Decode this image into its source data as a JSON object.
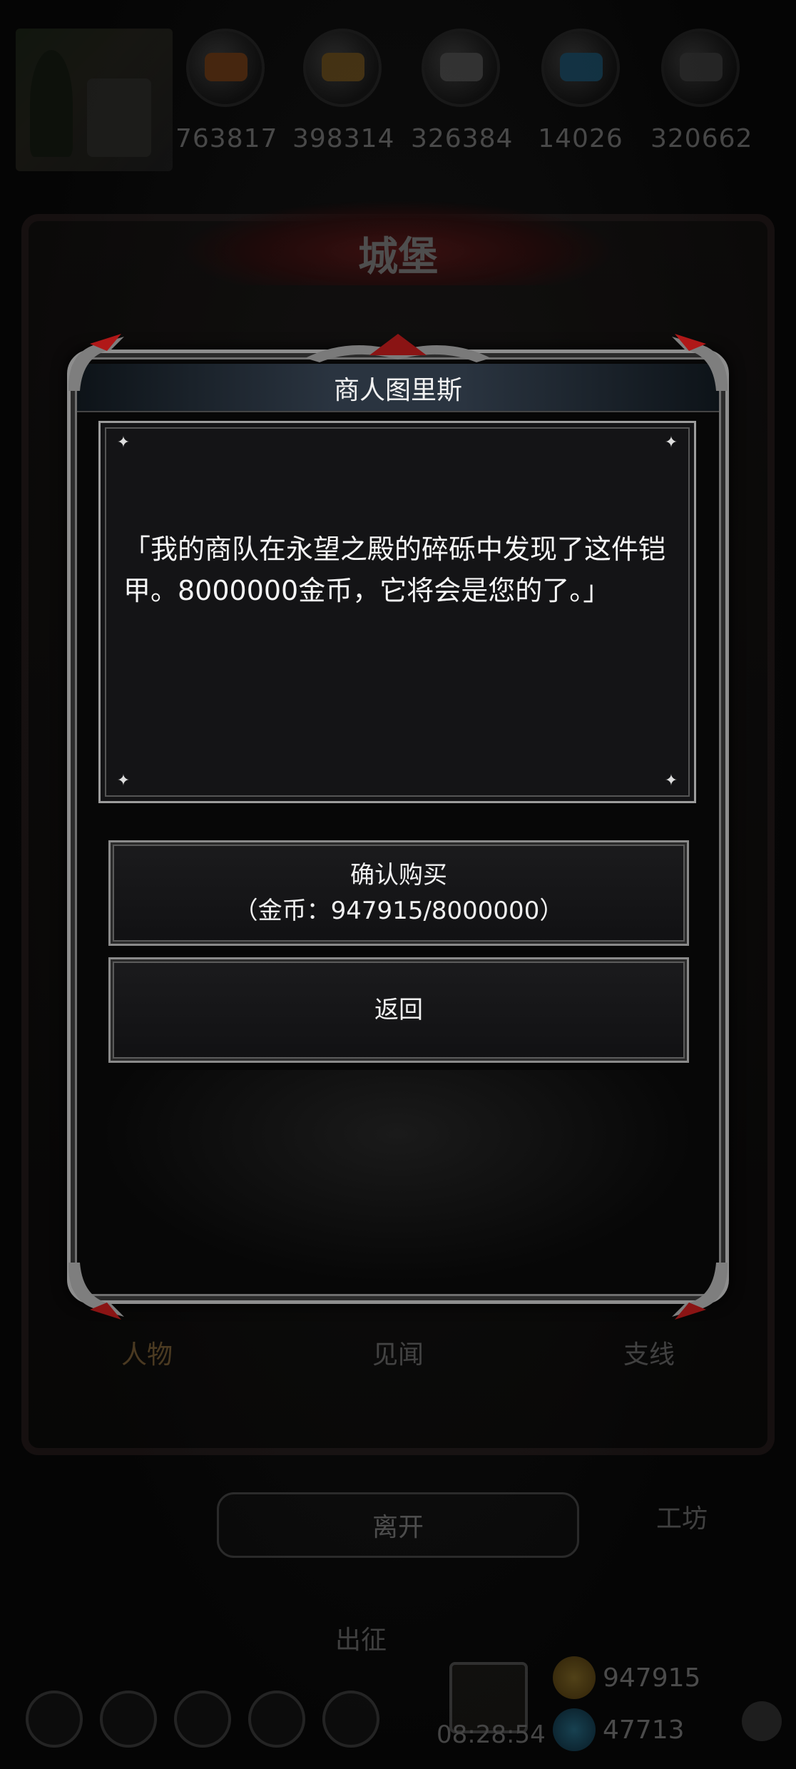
{
  "resources": [
    {
      "icon": "bread-icon",
      "color": "#c8661e",
      "value": "763817"
    },
    {
      "icon": "wood-icon",
      "color": "#c08a2a",
      "value": "398314"
    },
    {
      "icon": "stone-icon",
      "color": "#8a8a8a",
      "value": "326384"
    },
    {
      "icon": "crystal-icon",
      "color": "#2a8ac0",
      "value": "14026"
    },
    {
      "icon": "iron-icon",
      "color": "#6a6a6a",
      "value": "320662"
    }
  ],
  "castle": {
    "title": "城堡",
    "tabs": [
      "人物",
      "见闻",
      "支线"
    ]
  },
  "bottom": {
    "leave_label": "离开",
    "workshop_label": "工坊",
    "expedition_label": "出征",
    "clock": "08:28:54",
    "gold": "947915",
    "gems": "47713"
  },
  "modal": {
    "title": "商人图里斯",
    "text": "「我的商队在永望之殿的碎砾中发现了这件铠甲。8000000金币，它将会是您的了。」",
    "confirm_label": "确认购买",
    "confirm_cost": "（金币：947915/8000000）",
    "back_label": "返回"
  },
  "colors": {
    "frame_silver": "#8e8e8e",
    "frame_red": "#b01818",
    "panel_bg": "#141416",
    "accent_gold": "#d9a55a"
  }
}
